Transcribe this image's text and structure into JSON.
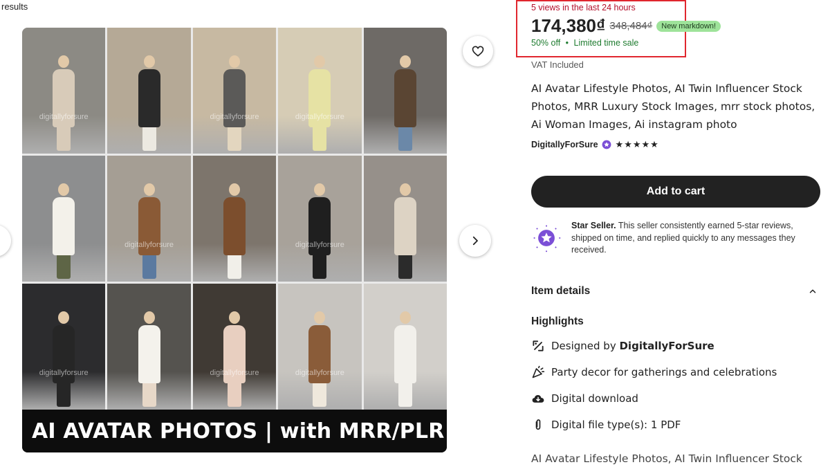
{
  "breadcrumb": {
    "results_label": "results"
  },
  "gallery": {
    "banner_text": "AI AVATAR PHOTOS | with MRR/PLR",
    "watermark": "digitallyforsure",
    "tiles": [
      {
        "bg": "#8c8a84",
        "top": "#d8cbb9",
        "bottom": "#d8cbb9"
      },
      {
        "bg": "#b5a996",
        "top": "#2a2a2a",
        "bottom": "#ece9e1"
      },
      {
        "bg": "#c7b9a2",
        "top": "#5b5a58",
        "bottom": "#e3d6bf"
      },
      {
        "bg": "#d6ccb5",
        "top": "#e6e2a4",
        "bottom": "#e6e2a4"
      },
      {
        "bg": "#6e6a66",
        "top": "#5a4533",
        "bottom": "#6b88a8"
      },
      {
        "bg": "#8d8e8f",
        "top": "#f3f1ea",
        "bottom": "#5e6546"
      },
      {
        "bg": "#a59e94",
        "top": "#8a5a36",
        "bottom": "#5b7aa0"
      },
      {
        "bg": "#7d756c",
        "top": "#7c4e2d",
        "bottom": "#f1efe9"
      },
      {
        "bg": "#a8a29a",
        "top": "#1f1f1f",
        "bottom": "#1f1f1f"
      },
      {
        "bg": "#96908a",
        "top": "#ddd3c4",
        "bottom": "#2b2b2b"
      },
      {
        "bg": "#2c2c2e",
        "top": "#262626",
        "bottom": "#262626"
      },
      {
        "bg": "#55534f",
        "top": "#f4f2ec",
        "bottom": "#e7d8c8"
      },
      {
        "bg": "#403a34",
        "top": "#e8cfc0",
        "bottom": "#e8cfc0"
      },
      {
        "bg": "#c7c4bf",
        "top": "#8a5c39",
        "bottom": "#efe8dc"
      },
      {
        "bg": "#d2cfca",
        "top": "#f2f0eb",
        "bottom": "#f2f0eb"
      }
    ]
  },
  "listing": {
    "views_text": "5 views in the last 24 hours",
    "price": "174,380₫",
    "original_price": "348,484₫",
    "markdown_badge": "New markdown!",
    "discount_text": "50% off",
    "separator": "•",
    "limited_text": "Limited time sale",
    "vat_text": "VAT Included",
    "title": "AI Avatar Lifestyle Photos, AI Twin Influencer Stock Photos, MRR Luxury Stock Images, mrr stock photos, Ai Woman Images, Ai instagram photo",
    "shop_name": "DigitallyForSure",
    "stars": "★★★★★",
    "rating": 5,
    "add_to_cart": "Add to cart",
    "star_seller_label": "Star Seller.",
    "star_seller_desc": " This seller consistently earned 5-star reviews, shipped on time, and replied quickly to any messages they received.",
    "item_details_label": "Item details",
    "highlights_label": "Highlights",
    "highlights": {
      "designed_prefix": "Designed by ",
      "designed_by": "DigitallyForSure",
      "occasion": "Party decor for gatherings and celebrations",
      "download": "Digital download",
      "file_types": "Digital file type(s): 1 PDF"
    },
    "description_start": "AI Avatar Lifestyle Photos, AI Twin Influencer Stock"
  },
  "colors": {
    "accent_red": "#b3102b",
    "highlight_border": "#e0262e",
    "sale_green": "#1e7b2f",
    "badge_green": "#9ee39a",
    "star_seller_purple": "#7b4fd6",
    "button_dark": "#222222"
  }
}
